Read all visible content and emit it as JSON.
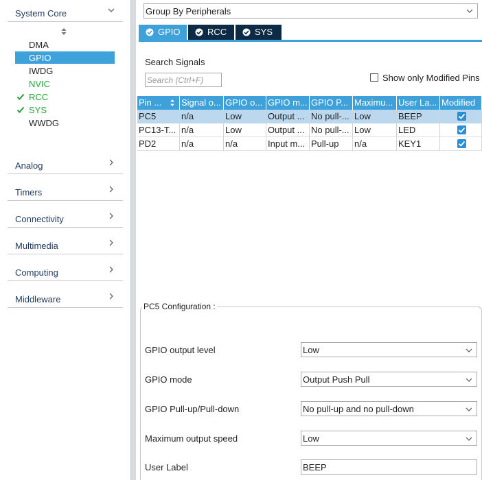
{
  "sidebar": {
    "system_core": {
      "label": "System Core",
      "items": [
        {
          "label": "DMA",
          "state": "normal"
        },
        {
          "label": "GPIO",
          "state": "selected"
        },
        {
          "label": "IWDG",
          "state": "normal"
        },
        {
          "label": "NVIC",
          "state": "green"
        },
        {
          "label": "RCC",
          "state": "checked"
        },
        {
          "label": "SYS",
          "state": "checked"
        },
        {
          "label": "WWDG",
          "state": "normal"
        }
      ]
    },
    "categories": [
      "Analog",
      "Timers",
      "Connectivity",
      "Multimedia",
      "Computing",
      "Middleware"
    ]
  },
  "group_by": {
    "value": "Group By Peripherals"
  },
  "tabs": [
    {
      "label": "GPIO",
      "active": true
    },
    {
      "label": "RCC",
      "active": false
    },
    {
      "label": "SYS",
      "active": false
    }
  ],
  "search": {
    "label": "Search Signals",
    "placeholder": "Search (Ctrl+F)"
  },
  "show_modified": {
    "label": "Show only Modified Pins",
    "checked": false
  },
  "table": {
    "headers": [
      "Pin ...",
      "Signal o...",
      "GPIO o...",
      "GPIO m...",
      "GPIO P...",
      "Maximu...",
      "User La...",
      "Modified"
    ],
    "rows": [
      {
        "cells": [
          "PC5",
          "n/a",
          "Low",
          "Output ...",
          "No pull-...",
          "Low",
          "BEEP"
        ],
        "modified": true,
        "selected": true
      },
      {
        "cells": [
          "PC13-T...",
          "n/a",
          "Low",
          "Output ...",
          "No pull-...",
          "Low",
          "LED"
        ],
        "modified": true,
        "selected": false
      },
      {
        "cells": [
          "PD2",
          "n/a",
          "n/a",
          "Input m...",
          "Pull-up",
          "n/a",
          "KEY1"
        ],
        "modified": true,
        "selected": false
      }
    ]
  },
  "config": {
    "title": "PC5 Configuration :",
    "fields": [
      {
        "label": "GPIO output level",
        "value": "Low"
      },
      {
        "label": "GPIO mode",
        "value": "Output Push Pull"
      },
      {
        "label": "GPIO Pull-up/Pull-down",
        "value": "No pull-up and no pull-down"
      },
      {
        "label": "Maximum output speed",
        "value": "Low"
      }
    ],
    "user_label": {
      "label": "User Label",
      "value": "BEEP"
    }
  },
  "colors": {
    "accent": "#3ea1d9",
    "tab_dark": "#0d2b45",
    "ok_green": "#27a039",
    "selected_row": "#bcd8ee"
  }
}
